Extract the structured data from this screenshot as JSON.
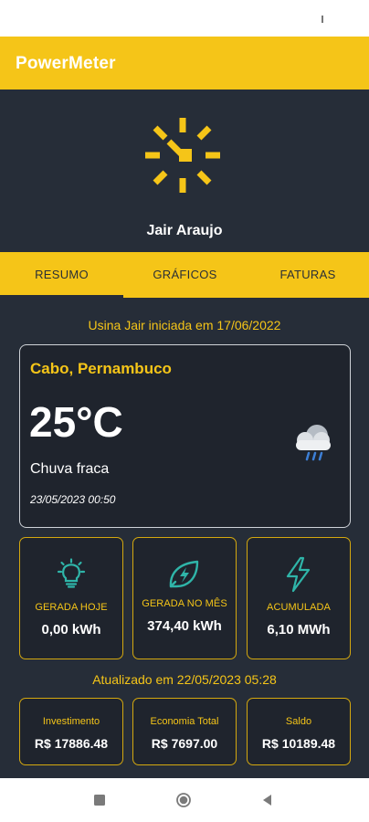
{
  "app": {
    "title": "PowerMeter"
  },
  "profile": {
    "name": "Jair Araujo",
    "logo_icon": "sun-icon"
  },
  "tabs": [
    {
      "label": "RESUMO",
      "active": true
    },
    {
      "label": "GRÁFICOS",
      "active": false
    },
    {
      "label": "FATURAS",
      "active": false
    }
  ],
  "plant": {
    "since_text": "Usina Jair iniciada em 17/06/2022"
  },
  "weather": {
    "city": "Cabo, Pernambuco",
    "temperature": "25°C",
    "condition": "Chuva fraca",
    "datetime": "23/05/2023 00:50",
    "icon": "cloud-rain-icon"
  },
  "stats": [
    {
      "label": "GERADA HOJE",
      "value": "0,00 kWh",
      "icon": "lightbulb-icon"
    },
    {
      "label": "GERADA NO MÊS",
      "value": "374,40 kWh",
      "icon": "leaf-bolt-icon"
    },
    {
      "label": "ACUMULADA",
      "value": "6,10 MWh",
      "icon": "lightning-icon"
    }
  ],
  "updated_text": "Atualizado em 22/05/2023 05:28",
  "finance": [
    {
      "label": "Investimento",
      "value": "R$ 17886.48"
    },
    {
      "label": "Economia Total",
      "value": "R$ 7697.00"
    },
    {
      "label": "Saldo",
      "value": "R$ 10189.48"
    }
  ],
  "colors": {
    "accent": "#f5c518",
    "background": "#262d38",
    "card": "#1f242d",
    "icon_teal": "#2fb5a9"
  },
  "system_nav": [
    "recents-button",
    "home-button",
    "back-button"
  ]
}
